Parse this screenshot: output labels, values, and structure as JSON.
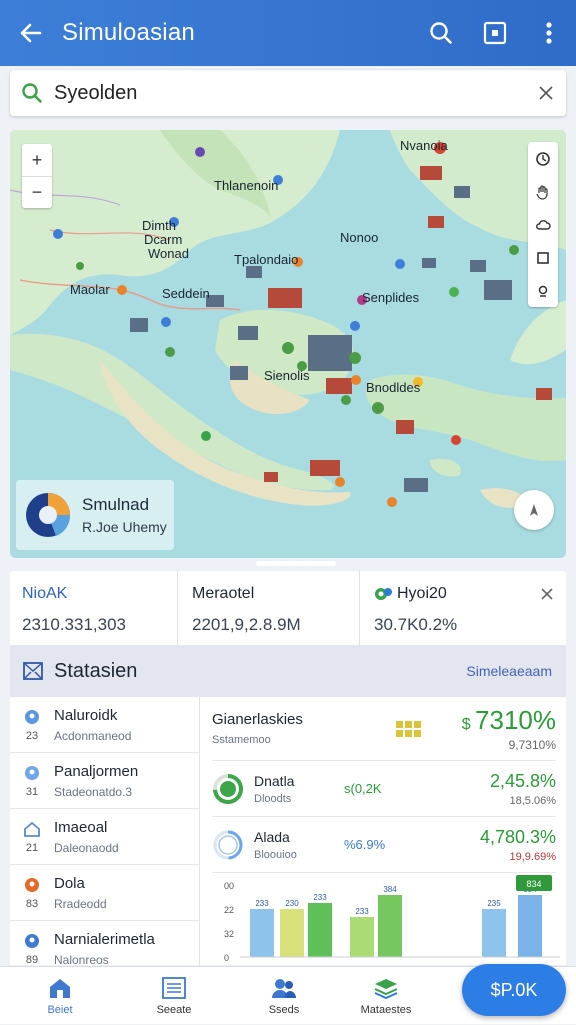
{
  "app": {
    "title": "Simuloasian",
    "colors": {
      "appbar": "#2f6cc9",
      "accent": "#2c7ee6",
      "positive": "#2e9a3a"
    }
  },
  "toolbar": {
    "back_icon": "arrow-left-icon",
    "search_icon": "search-icon",
    "frame_icon": "square-frame-icon",
    "more_icon": "more-vert-icon"
  },
  "search": {
    "value": "Syeolden",
    "clear_icon": "close-icon"
  },
  "map": {
    "labels": {
      "top_right": "Nvanoia",
      "north": "Thlanenoin",
      "west1": "Dimth",
      "west2": "Dcarm",
      "west3": "Wonad",
      "mid1": "Tpalondaio",
      "mid2": "Nonoo",
      "left": "Maolar",
      "left2": "Seddein",
      "east": "Senplides",
      "center": "Sienolis",
      "southeast": "Bnodldes"
    },
    "legend": {
      "title": "Smulnad",
      "subtitle": "R.Joe Uhemy"
    },
    "zoom": {
      "in": "+",
      "out": "−"
    }
  },
  "stats": [
    {
      "label": "NioAK",
      "value": "2310.331,303"
    },
    {
      "label": "Meraotel",
      "value": "2201,9,2.8.9M"
    },
    {
      "label": "Hyoi20",
      "value": "30.7K0.2%"
    }
  ],
  "section": {
    "title": "Statasien",
    "link": "Simeleaeaam"
  },
  "left_list": [
    {
      "title": "Naluroidk",
      "subtitle": "Acdonmaneod",
      "num": "23",
      "color": "#5c97e0",
      "icon": "pin-icon"
    },
    {
      "title": "Panaljormen",
      "subtitle": "Stadeonatdo.3",
      "num": "31",
      "color": "#6fa7e8",
      "icon": "pin-icon"
    },
    {
      "title": "Imaeoal",
      "subtitle": "Daleonaodd",
      "num": "21",
      "color": "#5b86d6",
      "icon": "house-icon"
    },
    {
      "title": "Dola",
      "subtitle": "Rradeodd",
      "num": "83",
      "color": "#e46a2a",
      "icon": "dot-icon"
    },
    {
      "title": "Narnialerimetla",
      "subtitle": "Nalonreos",
      "num": "89",
      "color": "#3e79cf",
      "icon": "pin-icon"
    }
  ],
  "right_pane": {
    "header": {
      "title": "Gianerlaskies",
      "subtitle": "Sstamemoo",
      "value": "7310%",
      "sub": "9,7310%"
    },
    "rows": [
      {
        "name": "Dnatla",
        "sub": "Dloodts",
        "mid": "s(0,2K",
        "value": "2,45.8%",
        "sub2": "18,5.06%",
        "value_color": "#2e9a3a",
        "ring_color": "#3da54a"
      },
      {
        "name": "Alada",
        "sub": "Bloouioo",
        "mid": "%6.9%",
        "value": "4,780.3%",
        "sub2": "19,9.69%",
        "value_color": "#2e9a3a",
        "ring_color": "#6aa6e8"
      }
    ],
    "chart_data": {
      "type": "bar",
      "y_ticks": [
        "00",
        "22",
        "32",
        "0"
      ],
      "bars": [
        {
          "label": "233",
          "value": 233,
          "color": "#8ec3ec"
        },
        {
          "label": "230",
          "value": 230,
          "color": "#d8e07a"
        },
        {
          "label": "233",
          "value": 260,
          "color": "#5fc05a"
        },
        {
          "label": "233",
          "value": 195,
          "color": "#a9dc75"
        },
        {
          "label": "384",
          "value": 300,
          "color": "#76c75e"
        },
        {
          "label": "235",
          "value": 233,
          "color": "#8ec3ec"
        },
        {
          "label": "834",
          "value": 300,
          "color": "#7bb4e8"
        }
      ],
      "badge": "834"
    }
  },
  "bottom_nav": [
    {
      "label": "Beiet",
      "icon": "home-icon"
    },
    {
      "label": "Seeate",
      "icon": "list-icon"
    },
    {
      "label": "Sseds",
      "icon": "people-icon"
    },
    {
      "label": "Mataestes",
      "icon": "map-layers-icon"
    }
  ],
  "fab": {
    "label": "$P.0K"
  }
}
